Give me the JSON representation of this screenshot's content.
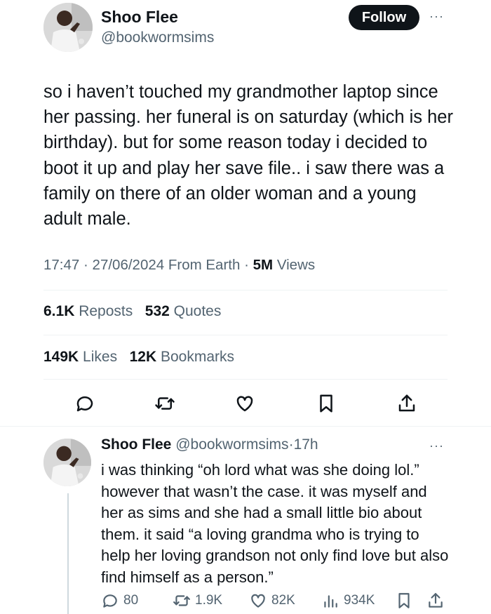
{
  "tweet": {
    "author_name": "Shoo Flee",
    "handle": "@bookwormsims",
    "follow_label": "Follow",
    "more_label": "···",
    "text": "so i haven’t touched my grandmother laptop since her passing. her funeral is on saturday (which is her birthday). but for some reason today i decided to boot it up and play her save file.. i saw there was a family on there of an older woman and a young adult male.",
    "time": "17:47",
    "date": "27/06/2024",
    "source": "From Earth",
    "views_count": "5M",
    "views_label": "Views",
    "sep": "·",
    "reposts_count": "6.1K",
    "reposts_label": "Reposts",
    "quotes_count": "532",
    "quotes_label": "Quotes",
    "likes_count": "149K",
    "likes_label": "Likes",
    "bookmarks_count": "12K",
    "bookmarks_label": "Bookmarks"
  },
  "actions": [
    "reply-icon",
    "repost-icon",
    "like-icon",
    "bookmark-icon",
    "share-icon"
  ],
  "reply": {
    "author_name": "Shoo Flee",
    "handle": "@bookwormsims",
    "age": "17h",
    "more_label": "···",
    "text": "i was thinking “oh lord what was she doing lol.” however that wasn’t the case. it was myself and her as sims and she had a small little bio about them. it said “a loving grandma who is trying to help her loving grandson not only find love but also find himself as a person.”",
    "replies": "80",
    "reposts": "1.9K",
    "likes": "82K",
    "views": "934K"
  },
  "colors": {
    "text": "#0f1419",
    "muted": "#536471",
    "divider": "#eff3f4",
    "button": "#0f1419"
  }
}
